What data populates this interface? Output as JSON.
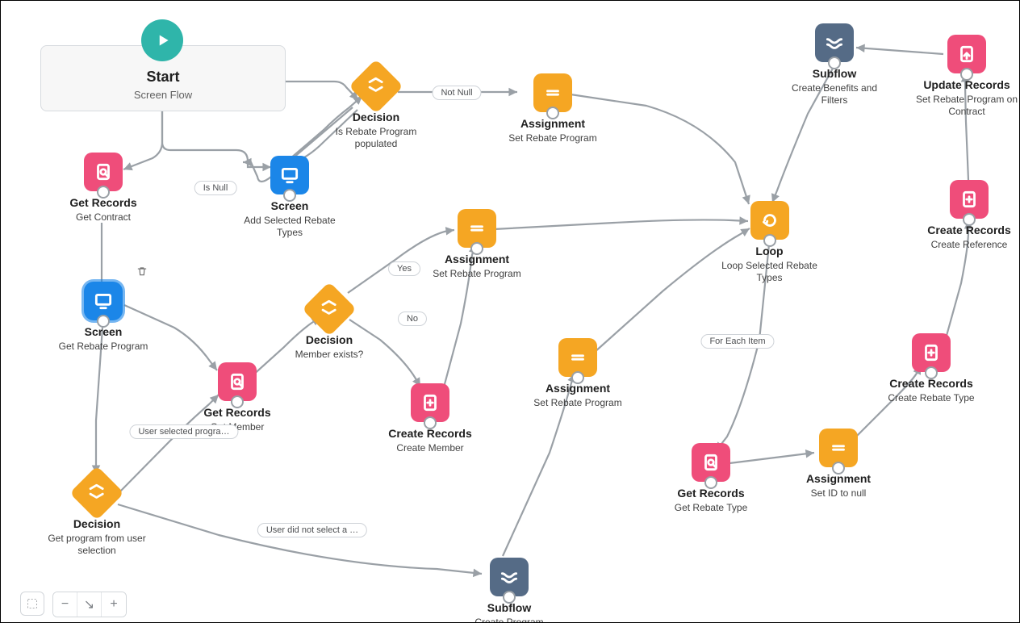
{
  "diagram": {
    "start": {
      "title_label": "Start",
      "sub_label": "Screen Flow"
    },
    "nodes": {
      "get_contract": {
        "title": "Get Records",
        "sub": "Get Contract"
      },
      "screen_add_types": {
        "title": "Screen",
        "sub": "Add Selected Rebate Types"
      },
      "screen_get_program": {
        "title": "Screen",
        "sub": "Get Rebate Program"
      },
      "decision_populated": {
        "title": "Decision",
        "sub": "Is Rebate Program populated"
      },
      "assign_set_program_1": {
        "title": "Assignment",
        "sub": "Set Rebate Program"
      },
      "assign_set_program_2": {
        "title": "Assignment",
        "sub": "Set Rebate Program"
      },
      "assign_set_program_3": {
        "title": "Assignment",
        "sub": "Set Rebate Program"
      },
      "decision_member": {
        "title": "Decision",
        "sub": "Member exists?"
      },
      "get_member": {
        "title": "Get Records",
        "sub": "Get Member"
      },
      "decision_program_sel": {
        "title": "Decision",
        "sub": "Get program from user selection"
      },
      "create_member": {
        "title": "Create Records",
        "sub": "Create Member"
      },
      "subflow_create_program": {
        "title": "Subflow",
        "sub": "Create Program"
      },
      "loop": {
        "title": "Loop",
        "sub": "Loop Selected Rebate Types"
      },
      "get_rebate_type": {
        "title": "Get Records",
        "sub": "Get Rebate Type"
      },
      "assign_set_id_null": {
        "title": "Assignment",
        "sub": "Set ID to null"
      },
      "create_rebate_type": {
        "title": "Create Records",
        "sub": "Create Rebate Type"
      },
      "subflow_benefits": {
        "title": "Subflow",
        "sub": "Create Benefits and Filters"
      },
      "update_records": {
        "title": "Update Records",
        "sub": "Set Rebate Program on Contract"
      },
      "create_reference": {
        "title": "Create Records",
        "sub": "Create Reference"
      }
    },
    "badges": {
      "not_null": "Not Null",
      "is_null": "Is Null",
      "yes": "Yes",
      "no": "No",
      "for_each": "For Each Item",
      "user_selected": "User selected progra…",
      "user_not_selected": "User did not select a …"
    }
  },
  "toolbar": {
    "select_hint": "Select",
    "zoom_out": "−",
    "fit": "↘",
    "zoom_in": "+"
  }
}
